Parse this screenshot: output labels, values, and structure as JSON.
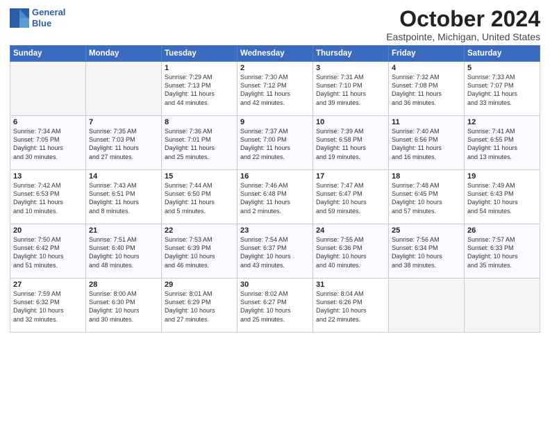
{
  "logo": {
    "line1": "General",
    "line2": "Blue"
  },
  "title": "October 2024",
  "location": "Eastpointe, Michigan, United States",
  "days_of_week": [
    "Sunday",
    "Monday",
    "Tuesday",
    "Wednesday",
    "Thursday",
    "Friday",
    "Saturday"
  ],
  "weeks": [
    [
      {
        "day": "",
        "detail": ""
      },
      {
        "day": "",
        "detail": ""
      },
      {
        "day": "1",
        "detail": "Sunrise: 7:29 AM\nSunset: 7:13 PM\nDaylight: 11 hours\nand 44 minutes."
      },
      {
        "day": "2",
        "detail": "Sunrise: 7:30 AM\nSunset: 7:12 PM\nDaylight: 11 hours\nand 42 minutes."
      },
      {
        "day": "3",
        "detail": "Sunrise: 7:31 AM\nSunset: 7:10 PM\nDaylight: 11 hours\nand 39 minutes."
      },
      {
        "day": "4",
        "detail": "Sunrise: 7:32 AM\nSunset: 7:08 PM\nDaylight: 11 hours\nand 36 minutes."
      },
      {
        "day": "5",
        "detail": "Sunrise: 7:33 AM\nSunset: 7:07 PM\nDaylight: 11 hours\nand 33 minutes."
      }
    ],
    [
      {
        "day": "6",
        "detail": "Sunrise: 7:34 AM\nSunset: 7:05 PM\nDaylight: 11 hours\nand 30 minutes."
      },
      {
        "day": "7",
        "detail": "Sunrise: 7:35 AM\nSunset: 7:03 PM\nDaylight: 11 hours\nand 27 minutes."
      },
      {
        "day": "8",
        "detail": "Sunrise: 7:36 AM\nSunset: 7:01 PM\nDaylight: 11 hours\nand 25 minutes."
      },
      {
        "day": "9",
        "detail": "Sunrise: 7:37 AM\nSunset: 7:00 PM\nDaylight: 11 hours\nand 22 minutes."
      },
      {
        "day": "10",
        "detail": "Sunrise: 7:39 AM\nSunset: 6:58 PM\nDaylight: 11 hours\nand 19 minutes."
      },
      {
        "day": "11",
        "detail": "Sunrise: 7:40 AM\nSunset: 6:56 PM\nDaylight: 11 hours\nand 16 minutes."
      },
      {
        "day": "12",
        "detail": "Sunrise: 7:41 AM\nSunset: 6:55 PM\nDaylight: 11 hours\nand 13 minutes."
      }
    ],
    [
      {
        "day": "13",
        "detail": "Sunrise: 7:42 AM\nSunset: 6:53 PM\nDaylight: 11 hours\nand 10 minutes."
      },
      {
        "day": "14",
        "detail": "Sunrise: 7:43 AM\nSunset: 6:51 PM\nDaylight: 11 hours\nand 8 minutes."
      },
      {
        "day": "15",
        "detail": "Sunrise: 7:44 AM\nSunset: 6:50 PM\nDaylight: 11 hours\nand 5 minutes."
      },
      {
        "day": "16",
        "detail": "Sunrise: 7:46 AM\nSunset: 6:48 PM\nDaylight: 11 hours\nand 2 minutes."
      },
      {
        "day": "17",
        "detail": "Sunrise: 7:47 AM\nSunset: 6:47 PM\nDaylight: 10 hours\nand 59 minutes."
      },
      {
        "day": "18",
        "detail": "Sunrise: 7:48 AM\nSunset: 6:45 PM\nDaylight: 10 hours\nand 57 minutes."
      },
      {
        "day": "19",
        "detail": "Sunrise: 7:49 AM\nSunset: 6:43 PM\nDaylight: 10 hours\nand 54 minutes."
      }
    ],
    [
      {
        "day": "20",
        "detail": "Sunrise: 7:50 AM\nSunset: 6:42 PM\nDaylight: 10 hours\nand 51 minutes."
      },
      {
        "day": "21",
        "detail": "Sunrise: 7:51 AM\nSunset: 6:40 PM\nDaylight: 10 hours\nand 48 minutes."
      },
      {
        "day": "22",
        "detail": "Sunrise: 7:53 AM\nSunset: 6:39 PM\nDaylight: 10 hours\nand 46 minutes."
      },
      {
        "day": "23",
        "detail": "Sunrise: 7:54 AM\nSunset: 6:37 PM\nDaylight: 10 hours\nand 43 minutes."
      },
      {
        "day": "24",
        "detail": "Sunrise: 7:55 AM\nSunset: 6:36 PM\nDaylight: 10 hours\nand 40 minutes."
      },
      {
        "day": "25",
        "detail": "Sunrise: 7:56 AM\nSunset: 6:34 PM\nDaylight: 10 hours\nand 38 minutes."
      },
      {
        "day": "26",
        "detail": "Sunrise: 7:57 AM\nSunset: 6:33 PM\nDaylight: 10 hours\nand 35 minutes."
      }
    ],
    [
      {
        "day": "27",
        "detail": "Sunrise: 7:59 AM\nSunset: 6:32 PM\nDaylight: 10 hours\nand 32 minutes."
      },
      {
        "day": "28",
        "detail": "Sunrise: 8:00 AM\nSunset: 6:30 PM\nDaylight: 10 hours\nand 30 minutes."
      },
      {
        "day": "29",
        "detail": "Sunrise: 8:01 AM\nSunset: 6:29 PM\nDaylight: 10 hours\nand 27 minutes."
      },
      {
        "day": "30",
        "detail": "Sunrise: 8:02 AM\nSunset: 6:27 PM\nDaylight: 10 hours\nand 25 minutes."
      },
      {
        "day": "31",
        "detail": "Sunrise: 8:04 AM\nSunset: 6:26 PM\nDaylight: 10 hours\nand 22 minutes."
      },
      {
        "day": "",
        "detail": ""
      },
      {
        "day": "",
        "detail": ""
      }
    ]
  ]
}
